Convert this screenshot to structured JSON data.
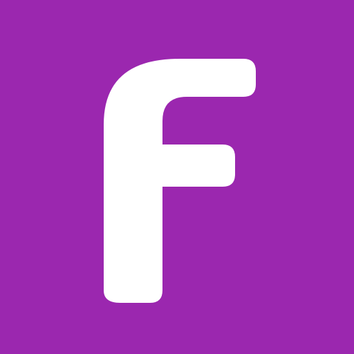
{
  "icon": {
    "name": "app-logo-letter-f",
    "letter": "F",
    "background_color": "#9b27af",
    "glyph_color": "#ffffff"
  }
}
